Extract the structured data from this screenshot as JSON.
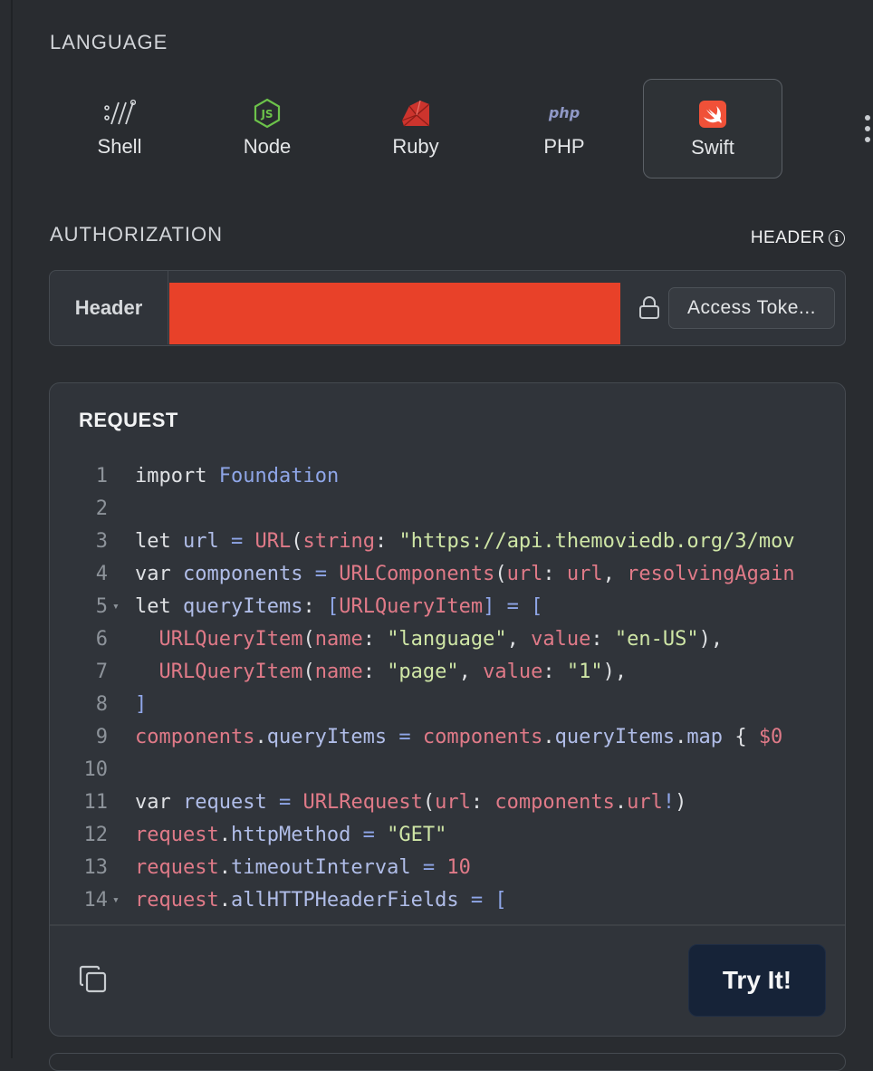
{
  "language": {
    "label": "LANGUAGE",
    "items": [
      {
        "name": "Shell",
        "icon": "shell-icon"
      },
      {
        "name": "Node",
        "icon": "nodejs-icon"
      },
      {
        "name": "Ruby",
        "icon": "ruby-icon"
      },
      {
        "name": "PHP",
        "icon": "php-icon"
      },
      {
        "name": "Swift",
        "icon": "swift-icon"
      }
    ],
    "selected": "Swift",
    "php_logo_text": "php",
    "node_logo_text": "JS"
  },
  "authorization": {
    "label": "AUTHORIZATION",
    "hint": "HEADER",
    "key": "Header",
    "token_button": "Access Toke...",
    "redacted_color": "#e84129"
  },
  "request": {
    "title": "REQUEST",
    "try_button": "Try It!",
    "code_lines": [
      "import Foundation",
      "",
      "let url = URL(string: \"https://api.themoviedb.org/3/mov",
      "var components = URLComponents(url: url, resolvingAgain",
      "let queryItems: [URLQueryItem] = [",
      "  URLQueryItem(name: \"language\", value: \"en-US\"),",
      "  URLQueryItem(name: \"page\", value: \"1\"),",
      "]",
      "components.queryItems = components.queryItems.map { $0",
      "",
      "var request = URLRequest(url: components.url!)",
      "request.httpMethod = \"GET\"",
      "request.timeoutInterval = 10",
      "request.allHTTPHeaderFields = ["
    ],
    "line_numbers": [
      "1",
      "2",
      "3",
      "4",
      "5",
      "6",
      "7",
      "8",
      "9",
      "10",
      "11",
      "12",
      "13",
      "14"
    ]
  },
  "colors": {
    "background": "#292c30",
    "panel": "#30343a",
    "try_button": "#162338",
    "swift_logo": "#f05138",
    "node_logo": "#6cc24a",
    "ruby_logo": "#cc342d"
  }
}
